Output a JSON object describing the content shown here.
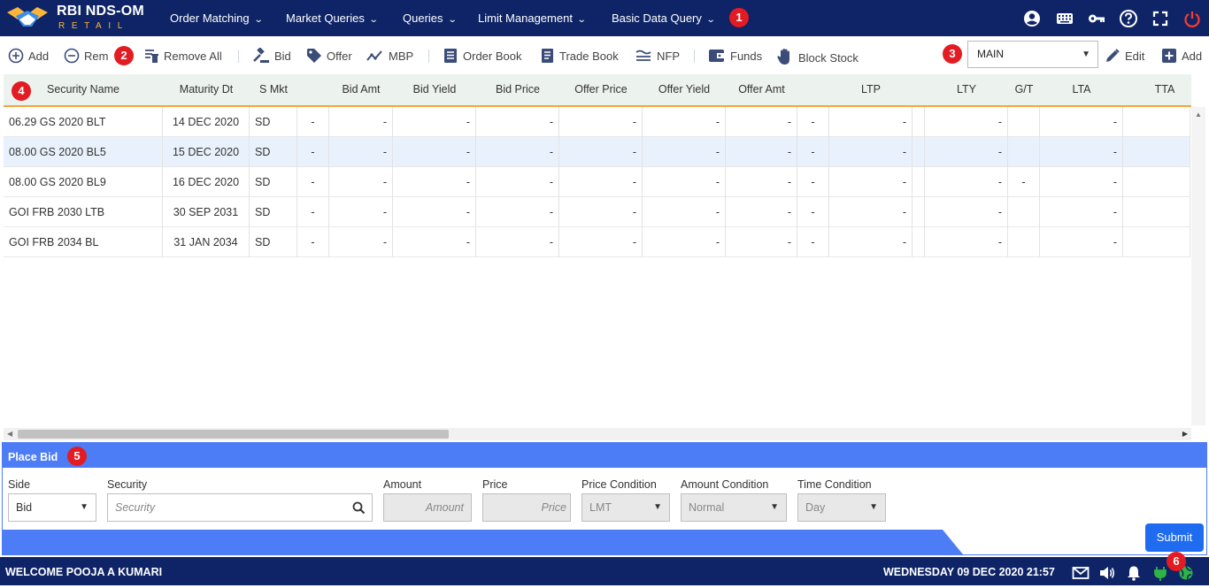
{
  "app": {
    "brand": "RBI NDS-OM",
    "brand_sub": "RETAIL"
  },
  "nav": {
    "menus": [
      "Order Matching",
      "Market Queries",
      "Queries",
      "Limit Management",
      "Basic Data Query"
    ]
  },
  "badges": [
    "1",
    "2",
    "3",
    "4",
    "5",
    "6"
  ],
  "toolbar": {
    "add": "Add",
    "remove": "Rem",
    "remove_all": "Remove All",
    "bid": "Bid",
    "offer": "Offer",
    "mbp": "MBP",
    "order_book": "Order Book",
    "trade_book": "Trade Book",
    "nfp": "NFP",
    "funds": "Funds",
    "block_stock": "Block Stock",
    "market_select": "MAIN",
    "edit": "Edit",
    "add2": "Add"
  },
  "grid": {
    "columns": [
      "Security Name",
      "Maturity Dt",
      "S Mkt",
      "Bid Amt",
      "Bid Yield",
      "Bid Price",
      "Offer Price",
      "Offer Yield",
      "Offer Amt",
      "LTP",
      "LTY",
      "G/T",
      "LTA",
      "TTA"
    ],
    "rows": [
      {
        "name": "06.29 GS 2020 BLT",
        "mat": "14 DEC 2020",
        "smkt": "SD",
        "vals": [
          "-",
          "-",
          "-",
          "-",
          "-",
          "-",
          "-",
          "-",
          "-",
          "-",
          "",
          "-"
        ]
      },
      {
        "name": "08.00 GS 2020 BL5",
        "mat": "15 DEC 2020",
        "smkt": "SD",
        "vals": [
          "-",
          "-",
          "-",
          "-",
          "-",
          "-",
          "-",
          "-",
          "-",
          "-",
          "",
          "-"
        ]
      },
      {
        "name": "08.00 GS 2020 BL9",
        "mat": "16 DEC 2020",
        "smkt": "SD",
        "vals": [
          "-",
          "-",
          "-",
          "-",
          "-",
          "-",
          "-",
          "-",
          "-",
          "-",
          "-",
          "-"
        ]
      },
      {
        "name": "GOI FRB 2030 LTB",
        "mat": "30 SEP 2031",
        "smkt": "SD",
        "vals": [
          "-",
          "-",
          "-",
          "-",
          "-",
          "-",
          "-",
          "-",
          "-",
          "-",
          "",
          "-"
        ]
      },
      {
        "name": "GOI FRB 2034 BL",
        "mat": "31 JAN 2034",
        "smkt": "SD",
        "vals": [
          "-",
          "-",
          "-",
          "-",
          "-",
          "-",
          "-",
          "-",
          "-",
          "-",
          "",
          "-"
        ]
      }
    ]
  },
  "place_bid": {
    "title": "Place Bid",
    "side_label": "Side",
    "side_value": "Bid",
    "security_label": "Security",
    "security_placeholder": "Security",
    "amount_label": "Amount",
    "amount_placeholder": "Amount",
    "price_label": "Price",
    "price_placeholder": "Price",
    "price_cond_label": "Price Condition",
    "price_cond_value": "LMT",
    "amount_cond_label": "Amount Condition",
    "amount_cond_value": "Normal",
    "time_cond_label": "Time Condition",
    "time_cond_value": "Day",
    "submit": "Submit"
  },
  "status": {
    "welcome": "WELCOME POOJA A KUMARI",
    "datetime": "WEDNESDAY 09 DEC 2020 21:57"
  }
}
